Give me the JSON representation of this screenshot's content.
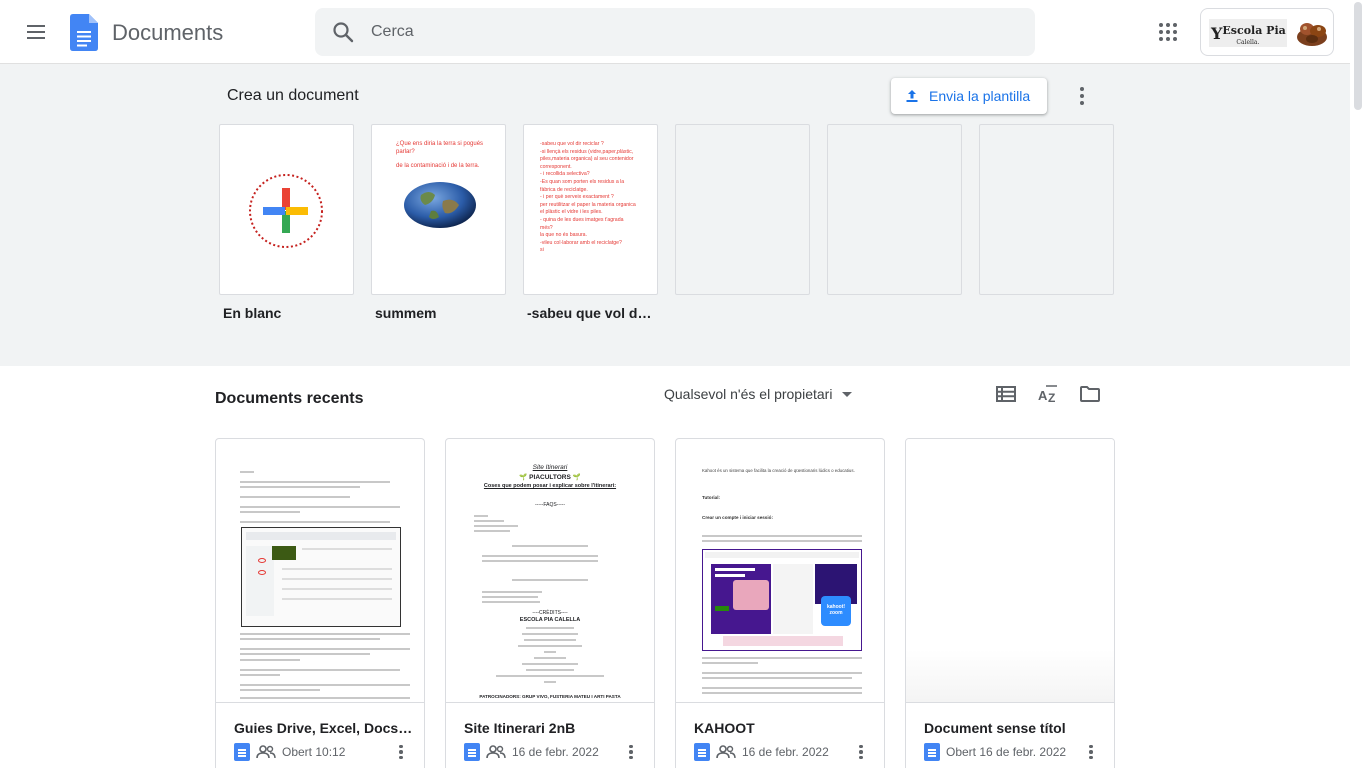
{
  "header": {
    "app_title": "Documents",
    "search_placeholder": "Cerca",
    "account_org_text_main": "Escola Pia",
    "account_org_text_sub": "Calella."
  },
  "templates": {
    "heading": "Crea un document",
    "send_button_label": "Envia la plantilla",
    "cards": [
      {
        "label": "En blanc"
      },
      {
        "label": "summem"
      },
      {
        "label": "-sabeu que vol di..."
      }
    ],
    "summem_lines": [
      "¿Que ens diria la terra si pogués",
      "parlar?",
      "",
      "de la contaminació i de la terra."
    ],
    "sabeu_lines": [
      "-sabeu que vol dir reciclar ?",
      "-si llençà els residus (vidre,paper,plàstic,",
      "piles,materia organica) al seu contenidor",
      "corresponent.",
      "- i recollida selectiva?",
      "-Es quan som porten els residus a la",
      "fàbrica de reciclatge.",
      "- i per què serveix exactament ?",
      "per reutilitzar el paper la materia organica",
      "el plàstic el vidre i les piles.",
      "- quina de les dues imatges t'agrada",
      "més?",
      "la que no és basura.",
      "-vileu col·laborar amb el reciclatge?",
      "si"
    ]
  },
  "recent": {
    "title": "Documents recents",
    "owner_filter": "Qualsevol n'és el propietari",
    "docs": [
      {
        "name": "Guies Drive, Excel, Docs i ...",
        "meta": "Obert 10:12"
      },
      {
        "name": "Site Itinerari 2nB",
        "meta": "16 de febr. 2022"
      },
      {
        "name": "KAHOOT",
        "meta": "16 de febr. 2022"
      },
      {
        "name": "Document sense títol",
        "meta": "Obert 16 de febr. 2022"
      }
    ],
    "site_doc": {
      "title": "Site Itinerari",
      "subtitle": "PIACULTORS",
      "question": "Coses que podem posar i explicar sobre l'itinerari:",
      "faqs": "-----FAQS-----",
      "credits": "----CRÈDITS----",
      "school": "ESCOLA PIA CALELLA",
      "patron": "PATROCINADORS: GRUP VIVO, FUSTERIA MATEU I ARTI PASTA"
    },
    "kahoot_doc": {
      "intro": "Kahoot és un sistema que facilita la creació de qüestionaris lúdics o educatius.",
      "tutorial": "Tutorial:",
      "step": "Crear un compte i iniciar sessió:"
    }
  },
  "colors": {
    "accent": "#1a73e8",
    "docs_blue": "#4285f4",
    "template_bg": "#f1f3f4"
  }
}
